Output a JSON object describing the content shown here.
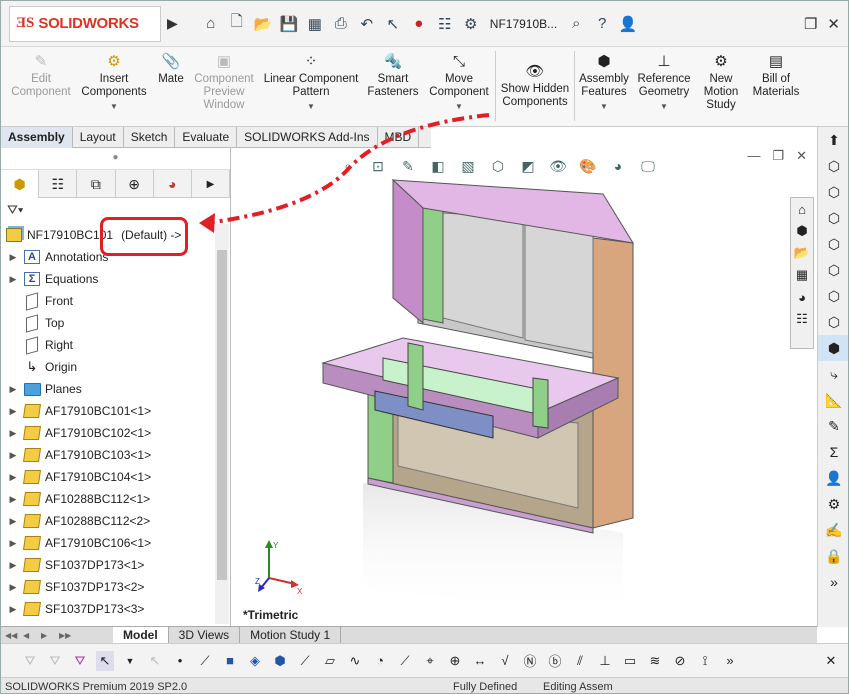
{
  "app": {
    "brand": "SOLIDWORKS",
    "doc_title": "NF17910B..."
  },
  "titlebar": {
    "icons": [
      "home-icon",
      "new-icon",
      "open-icon",
      "save-icon",
      "print-preview-icon",
      "print-icon",
      "undo-icon",
      "select-icon",
      "traffic-light-icon",
      "options-list-icon",
      "gear-icon",
      "search-icon",
      "help-icon",
      "user-icon",
      "restore-icon",
      "close-icon"
    ]
  },
  "ribbon": {
    "edit_component": "Edit Component",
    "insert_components": "Insert Components",
    "mate": "Mate",
    "component_preview": "Component Preview Window",
    "linear_pattern": "Linear Component Pattern",
    "smart_fasteners": "Smart Fasteners",
    "move_component": "Move Component",
    "show_hidden": "Show Hidden Components",
    "assembly_features": "Assembly Features",
    "reference_geometry": "Reference Geometry",
    "new_motion_study": "New Motion Study",
    "bill_of_materials": "Bill of Materials"
  },
  "command_tabs": [
    "Assembly",
    "Layout",
    "Sketch",
    "Evaluate",
    "SOLIDWORKS Add-Ins",
    "MBD"
  ],
  "tree": {
    "root_name": "NF17910BC101",
    "root_config": "(Default) ->",
    "items": [
      {
        "label": "Annotations",
        "icon": "annotations-icon"
      },
      {
        "label": "Equations",
        "icon": "equations-icon"
      },
      {
        "label": "Front",
        "icon": "plane-icon"
      },
      {
        "label": "Top",
        "icon": "plane-icon"
      },
      {
        "label": "Right",
        "icon": "plane-icon"
      },
      {
        "label": "Origin",
        "icon": "origin-icon"
      },
      {
        "label": "Planes",
        "icon": "folder-icon"
      },
      {
        "label": "AF17910BC101<1>",
        "icon": "part-icon"
      },
      {
        "label": "AF17910BC102<1>",
        "icon": "part-icon"
      },
      {
        "label": "AF17910BC103<1>",
        "icon": "part-icon"
      },
      {
        "label": "AF17910BC104<1>",
        "icon": "part-icon"
      },
      {
        "label": "AF10288BC112<1>",
        "icon": "part-icon"
      },
      {
        "label": "AF10288BC112<2>",
        "icon": "part-icon"
      },
      {
        "label": "AF17910BC106<1>",
        "icon": "part-icon"
      },
      {
        "label": "SF1037DP173<1>",
        "icon": "part-icon"
      },
      {
        "label": "SF1037DP173<2>",
        "icon": "part-icon"
      },
      {
        "label": "SF1037DP173<3>",
        "icon": "part-icon"
      }
    ]
  },
  "viewport": {
    "view_label": "*Trimetric"
  },
  "bottom_tabs": [
    "Model",
    "3D Views",
    "Motion Study 1"
  ],
  "status": {
    "left": "SOLIDWORKS Premium 2019 SP2.0",
    "mid": "Fully Defined",
    "mid2": "Editing Assem"
  },
  "colors": {
    "annotation_red": "#e31e24",
    "brand_red": "#dd3322"
  }
}
